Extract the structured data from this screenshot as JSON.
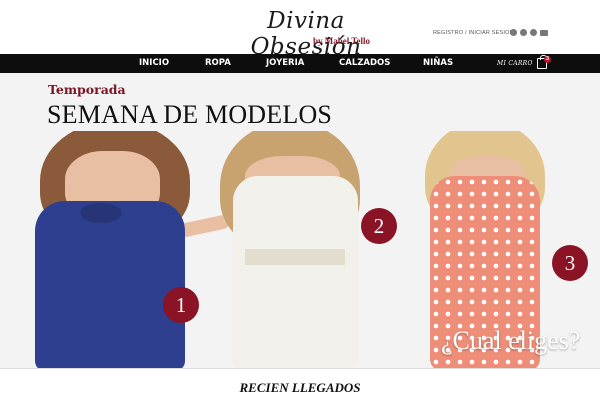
{
  "brand": {
    "name": "Divina Obsesión",
    "byline": "by Mabel Tello"
  },
  "header": {
    "account_link": "REGISTRO / INICIAR SESION",
    "social_icons": [
      "instagram-icon",
      "facebook-icon",
      "twitter-icon",
      "mail-icon"
    ]
  },
  "nav": {
    "items": [
      "INICIO",
      "ROPA",
      "JOYERIA",
      "CALZADOS",
      "NIÑAS"
    ],
    "cart_label": "MI CARRO",
    "cart_count": "3"
  },
  "hero": {
    "subtitle": "Temporada",
    "title": "SEMANA DE MODELOS",
    "badges": [
      "1",
      "2",
      "3"
    ],
    "question": "¿Cual eliges?"
  },
  "section": {
    "title": "RECIEN LLEGADOS"
  },
  "colors": {
    "accent": "#8a1426",
    "nav_bg": "#0d0d0d",
    "dress_1": "#2f3f8f",
    "dress_2": "#f2f0ea",
    "dress_3": "#ef8e78"
  }
}
